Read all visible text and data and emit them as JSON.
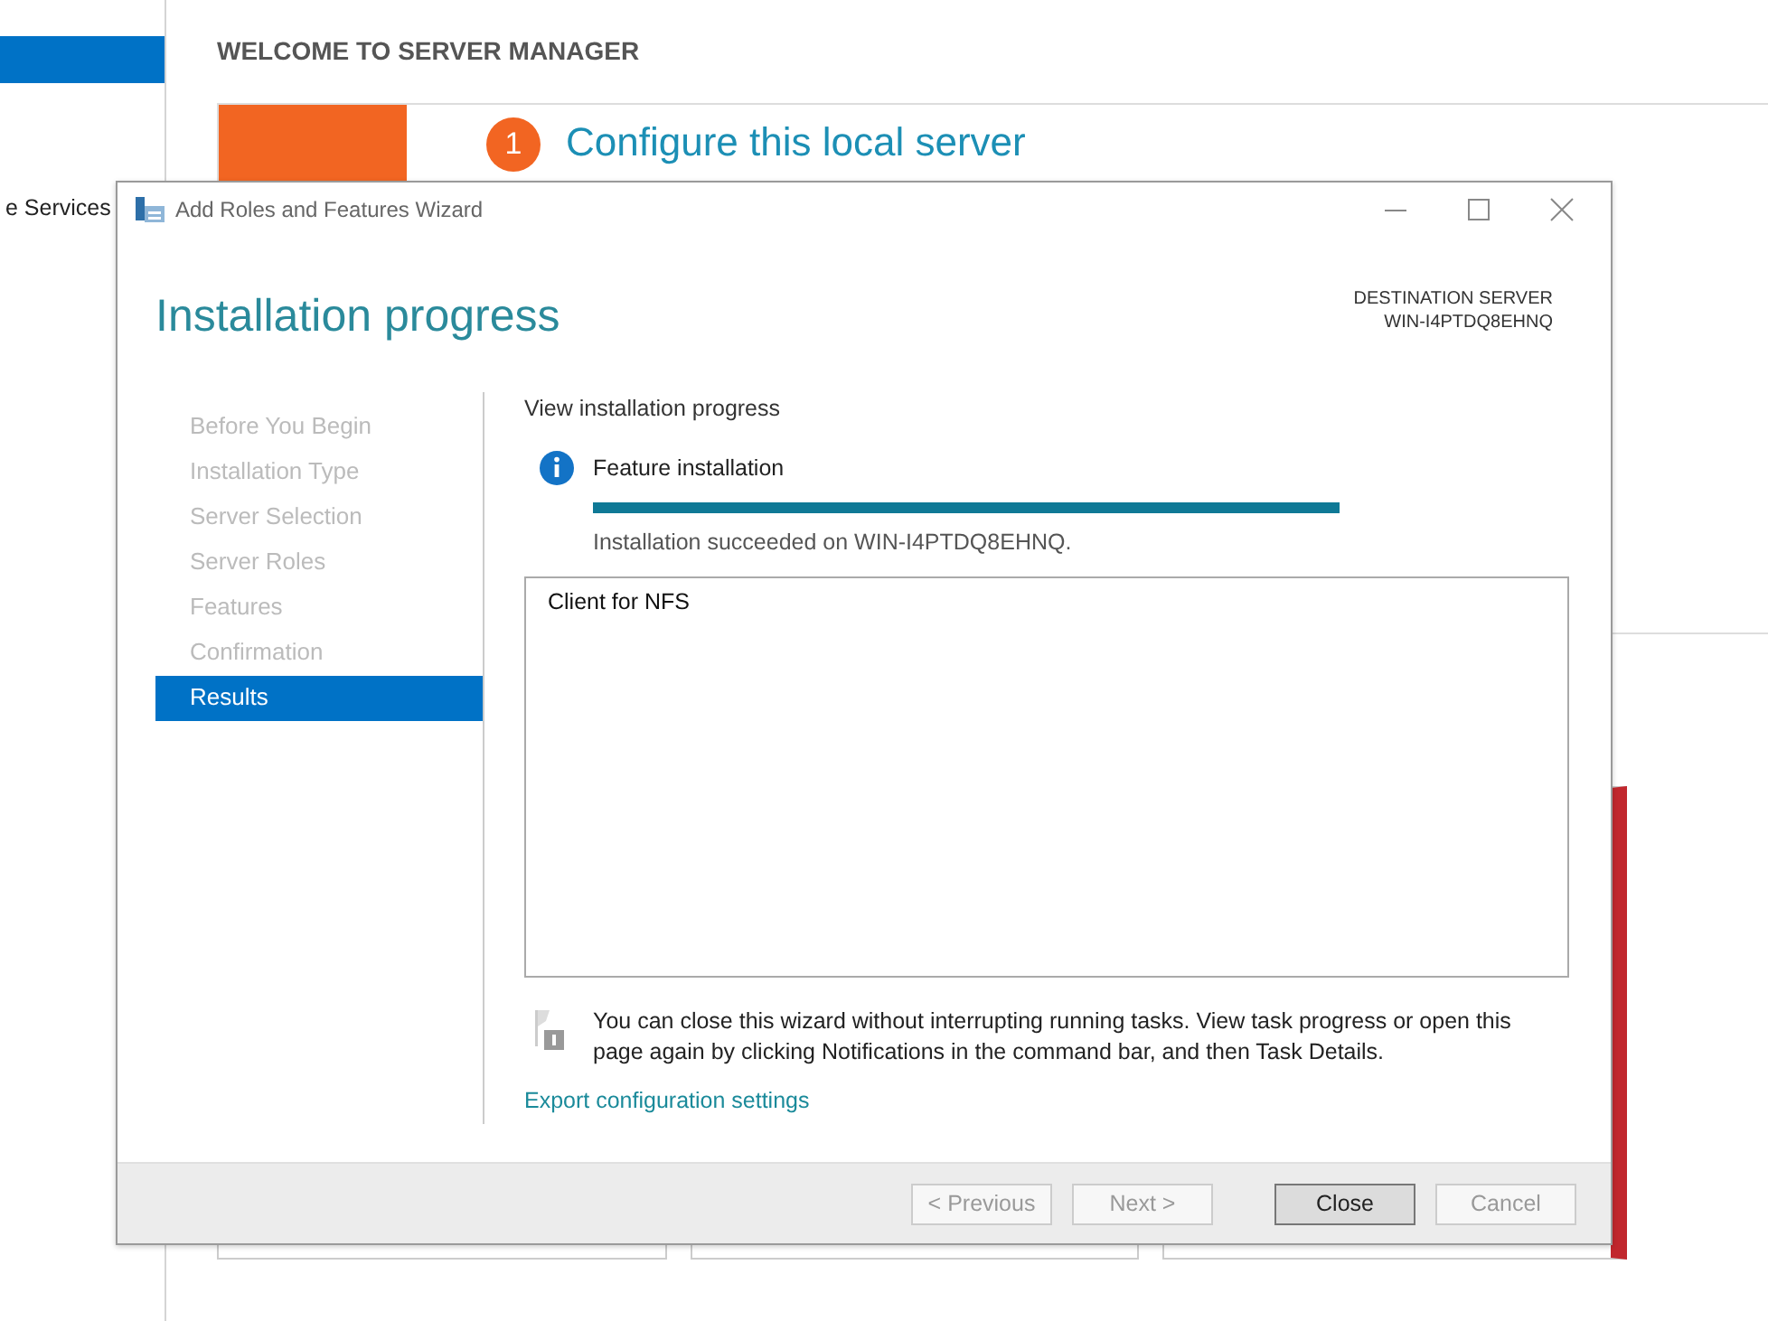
{
  "background": {
    "sidebar": {
      "items": [
        {
          "selected": true
        },
        {
          "label": "e Services",
          "selected": false
        }
      ]
    },
    "title": "WELCOME TO SERVER MANAGER",
    "quick_start": {
      "step": "1",
      "heading": "Configure this local server"
    },
    "tiles": [
      {
        "alert": false
      },
      {
        "alert": false
      },
      {
        "alert": true
      }
    ]
  },
  "window": {
    "title": "Add Roles and Features Wizard"
  },
  "heading": "Installation progress",
  "destination": {
    "label": "DESTINATION SERVER",
    "server": "WIN-I4PTDQ8EHNQ"
  },
  "steps": [
    {
      "label": "Before You Begin",
      "selected": false
    },
    {
      "label": "Installation Type",
      "selected": false
    },
    {
      "label": "Server Selection",
      "selected": false
    },
    {
      "label": "Server Roles",
      "selected": false
    },
    {
      "label": "Features",
      "selected": false
    },
    {
      "label": "Confirmation",
      "selected": false
    },
    {
      "label": "Results",
      "selected": true
    }
  ],
  "section_label": "View installation progress",
  "task": {
    "label": "Feature installation",
    "level": 1,
    "status": "Installation succeeded on WIN-I4PTDQ8EHNQ."
  },
  "results": [
    "Client for NFS"
  ],
  "note": "You can close this wizard without interrupting running tasks. View task progress or open this page again by clicking Notifications in the command bar, and then Task Details.",
  "link": "Export configuration settings",
  "buttons": [
    {
      "label": "< Previous",
      "disabled": true,
      "default": false
    },
    {
      "label": "Next >",
      "disabled": true,
      "default": false
    },
    {
      "label": "Close",
      "disabled": false,
      "default": true
    },
    {
      "label": "Cancel",
      "disabled": true,
      "default": false
    }
  ]
}
